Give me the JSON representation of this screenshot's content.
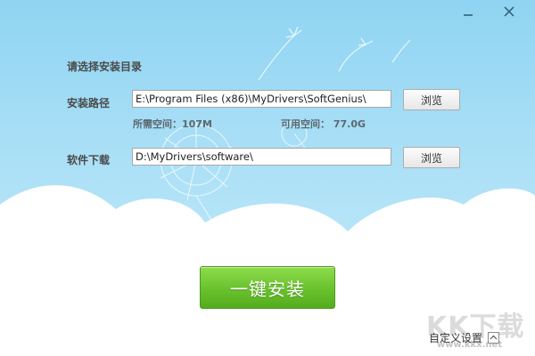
{
  "window": {
    "minimize_icon": "minimize-icon",
    "close_icon": "close-icon"
  },
  "form": {
    "section_title": "请选择安装目录",
    "install_path": {
      "label": "安装路径",
      "value": "E:\\Program Files (x86)\\MyDrivers\\SoftGenius\\",
      "browse_label": "浏览"
    },
    "space": {
      "required": "所需空间：107M",
      "available": "可用空间： 77.0G"
    },
    "download_path": {
      "label": "软件下载",
      "value": "D:\\MyDrivers\\software\\",
      "browse_label": "浏览"
    }
  },
  "actions": {
    "install_label": "一键安装",
    "custom_settings_label": "自定义设置",
    "expand_icon": "chevron-up-icon"
  },
  "watermark": {
    "logo": "KK下载",
    "url": "www.kkx.net"
  },
  "colors": {
    "sky": "#a9dff6",
    "install_button": "#6cc42f",
    "background": "#ffffff"
  }
}
